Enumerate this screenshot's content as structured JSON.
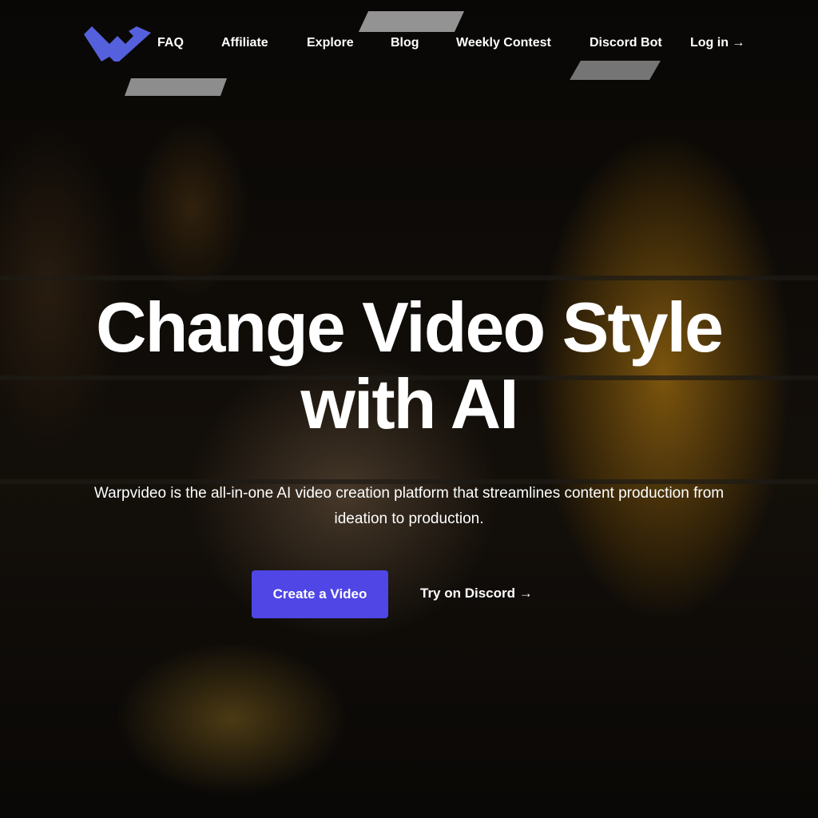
{
  "brand": {
    "name": "Warpvideo",
    "logo_icon": "w-logo-icon",
    "accent_color": "#5561dc"
  },
  "nav": {
    "items": [
      {
        "label": "FAQ"
      },
      {
        "label": "Affiliate"
      },
      {
        "label": "Explore"
      },
      {
        "label": "Blog"
      },
      {
        "label": "Weekly Contest"
      },
      {
        "label": "Discord Bot"
      }
    ],
    "login_label": "Log in →"
  },
  "hero": {
    "title_line1": "Change Video Style",
    "title_line2": "with AI",
    "subtitle": "Warpvideo is the all-in-one AI video creation platform that streamlines content production from ideation to production.",
    "primary_cta": "Create a Video",
    "primary_color": "#4f46e5",
    "secondary_cta": "Try on Discord →"
  }
}
